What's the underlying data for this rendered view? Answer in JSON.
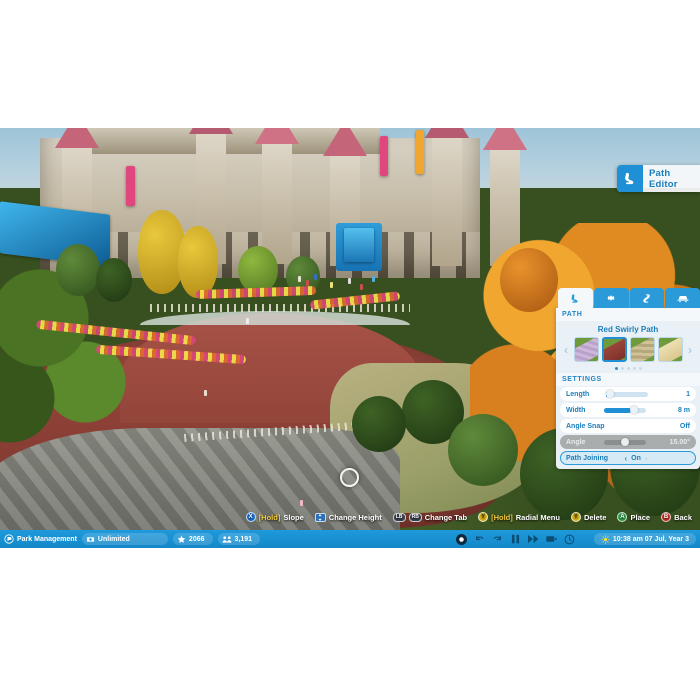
{
  "app": {
    "title": "Path Editor"
  },
  "badge": {
    "label": "Path Editor",
    "icon": "path-editor-icon"
  },
  "panel": {
    "tabs": [
      {
        "name": "tab-path",
        "icon": "path-icon",
        "active": true
      },
      {
        "name": "tab-scenery",
        "icon": "gear-icon",
        "active": false
      },
      {
        "name": "tab-queue",
        "icon": "queue-icon",
        "active": false
      },
      {
        "name": "tab-ride",
        "icon": "ride-icon",
        "active": false
      }
    ],
    "path_section": {
      "header": "PATH",
      "selected_name": "Red Swirly Path",
      "prev_arrow": "‹",
      "next_arrow": "›",
      "swatches": [
        {
          "name": "swatch-lilac-cobble",
          "color": "#c9b5d6",
          "selected": false
        },
        {
          "name": "swatch-red-swirly",
          "color": "#8b3b31",
          "selected": true
        },
        {
          "name": "swatch-tan-gravel",
          "color": "#c9bd8e",
          "selected": false
        },
        {
          "name": "swatch-sand",
          "color": "#e2d3a2",
          "selected": false
        }
      ],
      "page_dots": {
        "count": 5,
        "active_index": 0
      }
    },
    "settings_section": {
      "header": "SETTINGS",
      "rows": [
        {
          "name": "setting-length",
          "label": "Length",
          "value": "1",
          "control": "slider",
          "fill_pct": 4,
          "knob_pct": 2,
          "disabled": false,
          "focused": false
        },
        {
          "name": "setting-width",
          "label": "Width",
          "value": "8 m",
          "control": "slider",
          "fill_pct": 66,
          "knob_pct": 66,
          "disabled": false,
          "focused": false
        },
        {
          "name": "setting-angle-snap",
          "label": "Angle Snap",
          "value": "Off",
          "control": "text",
          "disabled": false,
          "focused": false
        },
        {
          "name": "setting-angle",
          "label": "Angle",
          "value": "15.00°",
          "control": "slider",
          "fill_pct": 0,
          "knob_pct": 44,
          "disabled": true,
          "focused": false
        },
        {
          "name": "setting-path-joining",
          "label": "Path Joining",
          "value": "On",
          "control": "stepper",
          "left_chev": "‹",
          "right_chev": "›",
          "disabled": false,
          "focused": true
        }
      ]
    }
  },
  "hints": [
    {
      "name": "hint-slope",
      "button": "X",
      "glyph_class": "x",
      "hold": "[Hold]",
      "label": "Slope"
    },
    {
      "name": "hint-change-height",
      "button": "",
      "glyph_class": "dpad",
      "hold": "",
      "label": "Change Height"
    },
    {
      "name": "hint-change-tab",
      "button": "LB",
      "glyph_class": "bump",
      "button2": "RB",
      "hold": "",
      "label": "Change Tab"
    },
    {
      "name": "hint-radial-menu",
      "button": "Y",
      "glyph_class": "y",
      "hold": "[Hold]",
      "label": "Radial Menu"
    },
    {
      "name": "hint-delete",
      "button": "Y",
      "glyph_class": "y",
      "hold": "",
      "label": "Delete"
    },
    {
      "name": "hint-place",
      "button": "A",
      "glyph_class": "a",
      "hold": "",
      "label": "Place"
    },
    {
      "name": "hint-back",
      "button": "B",
      "glyph_class": "b",
      "hold": "",
      "label": "Back"
    }
  ],
  "status_bar": {
    "park_management": "Park Management",
    "money": "Unlimited",
    "guests": "2066",
    "rating": "3,191",
    "datetime": "10:38 am 07 Jul, Year 3",
    "playback": [
      {
        "name": "record-button",
        "icon": "record-icon"
      },
      {
        "name": "undo-button",
        "icon": "undo-icon"
      },
      {
        "name": "redo-button",
        "icon": "redo-icon"
      },
      {
        "name": "pause-button",
        "icon": "pause-icon"
      },
      {
        "name": "fast-forward-button",
        "icon": "fast-forward-icon"
      },
      {
        "name": "camera-button",
        "icon": "camera-icon"
      },
      {
        "name": "clock-button",
        "icon": "clock-icon"
      }
    ]
  },
  "colors": {
    "accent_blue": "#1f8fd6",
    "panel_bg": "#e9f1f6",
    "status_bar": "#1287c9",
    "hold_yellow": "#f2c93b"
  }
}
